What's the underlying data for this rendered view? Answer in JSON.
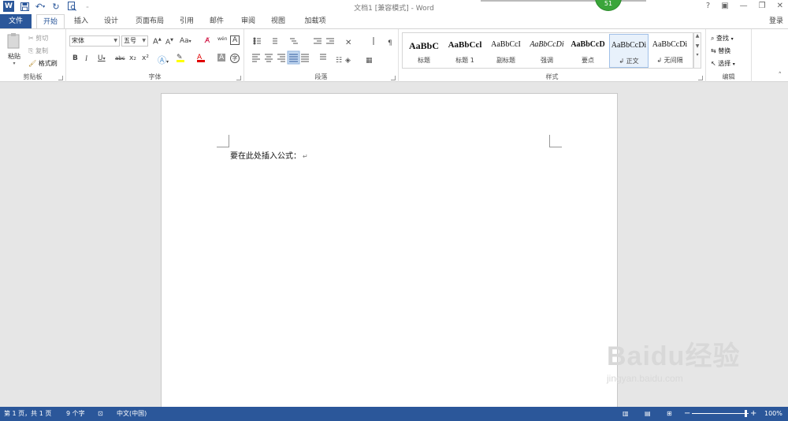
{
  "window": {
    "title": "文档1 [兼容模式] - Word",
    "notification_count": "51",
    "controls": [
      "?",
      "▣",
      "—",
      "❐",
      "✕"
    ]
  },
  "qat": {
    "icons": [
      "word-logo",
      "save-icon",
      "undo-icon",
      "redo-icon",
      "print-preview-icon",
      "customize-icon"
    ]
  },
  "tabs": {
    "file": "文件",
    "items": [
      "开始",
      "插入",
      "设计",
      "页面布局",
      "引用",
      "邮件",
      "审阅",
      "视图",
      "加载项"
    ],
    "active": "开始",
    "login": "登录"
  },
  "ribbon": {
    "clipboard": {
      "label": "剪贴板",
      "paste": "粘贴",
      "cut": "剪切",
      "copy": "复制",
      "format_painter": "格式刷"
    },
    "font": {
      "label": "字体",
      "font_name": "宋体",
      "font_size": "五号",
      "change_case": "Aa",
      "phonetic": "wén",
      "bold": "B",
      "italic": "I",
      "underline": "U",
      "strike": "abc",
      "subscript": "x₂",
      "superscript": "x²",
      "grow": "A",
      "shrink": "A",
      "char_border": "A",
      "shading": "A",
      "enclose": "字"
    },
    "paragraph": {
      "label": "段落"
    },
    "styles": {
      "label": "样式",
      "items": [
        {
          "sample": "AaBbC",
          "name": "标题"
        },
        {
          "sample": "AaBbCcl",
          "name": "标题 1"
        },
        {
          "sample": "AaBbCcI",
          "name": "副标题"
        },
        {
          "sample": "AaBbCcDi",
          "name": "强调"
        },
        {
          "sample": "AaBbCcD",
          "name": "要点"
        },
        {
          "sample": "AaBbCcDi",
          "name": "↲ 正文"
        },
        {
          "sample": "AaBbCcDi",
          "name": "↲ 无间隔"
        }
      ],
      "selected_index": 5
    },
    "editing": {
      "label": "编辑",
      "find": "查找",
      "replace": "替换",
      "select": "选择"
    }
  },
  "document": {
    "body_text": "要在此处插入公式：",
    "para_mark": "↵"
  },
  "watermark": {
    "main": "Baidu经验",
    "sub": "jingyan.baidu.com"
  },
  "status": {
    "page": "第 1 页，共 1 页",
    "words": "9 个字",
    "language": "中文(中国)",
    "zoom": "100%",
    "zoom_fraction": 0.5
  },
  "colors": {
    "accent": "#2b579a",
    "font_color": "#e00000",
    "highlight": "#ffff00"
  }
}
